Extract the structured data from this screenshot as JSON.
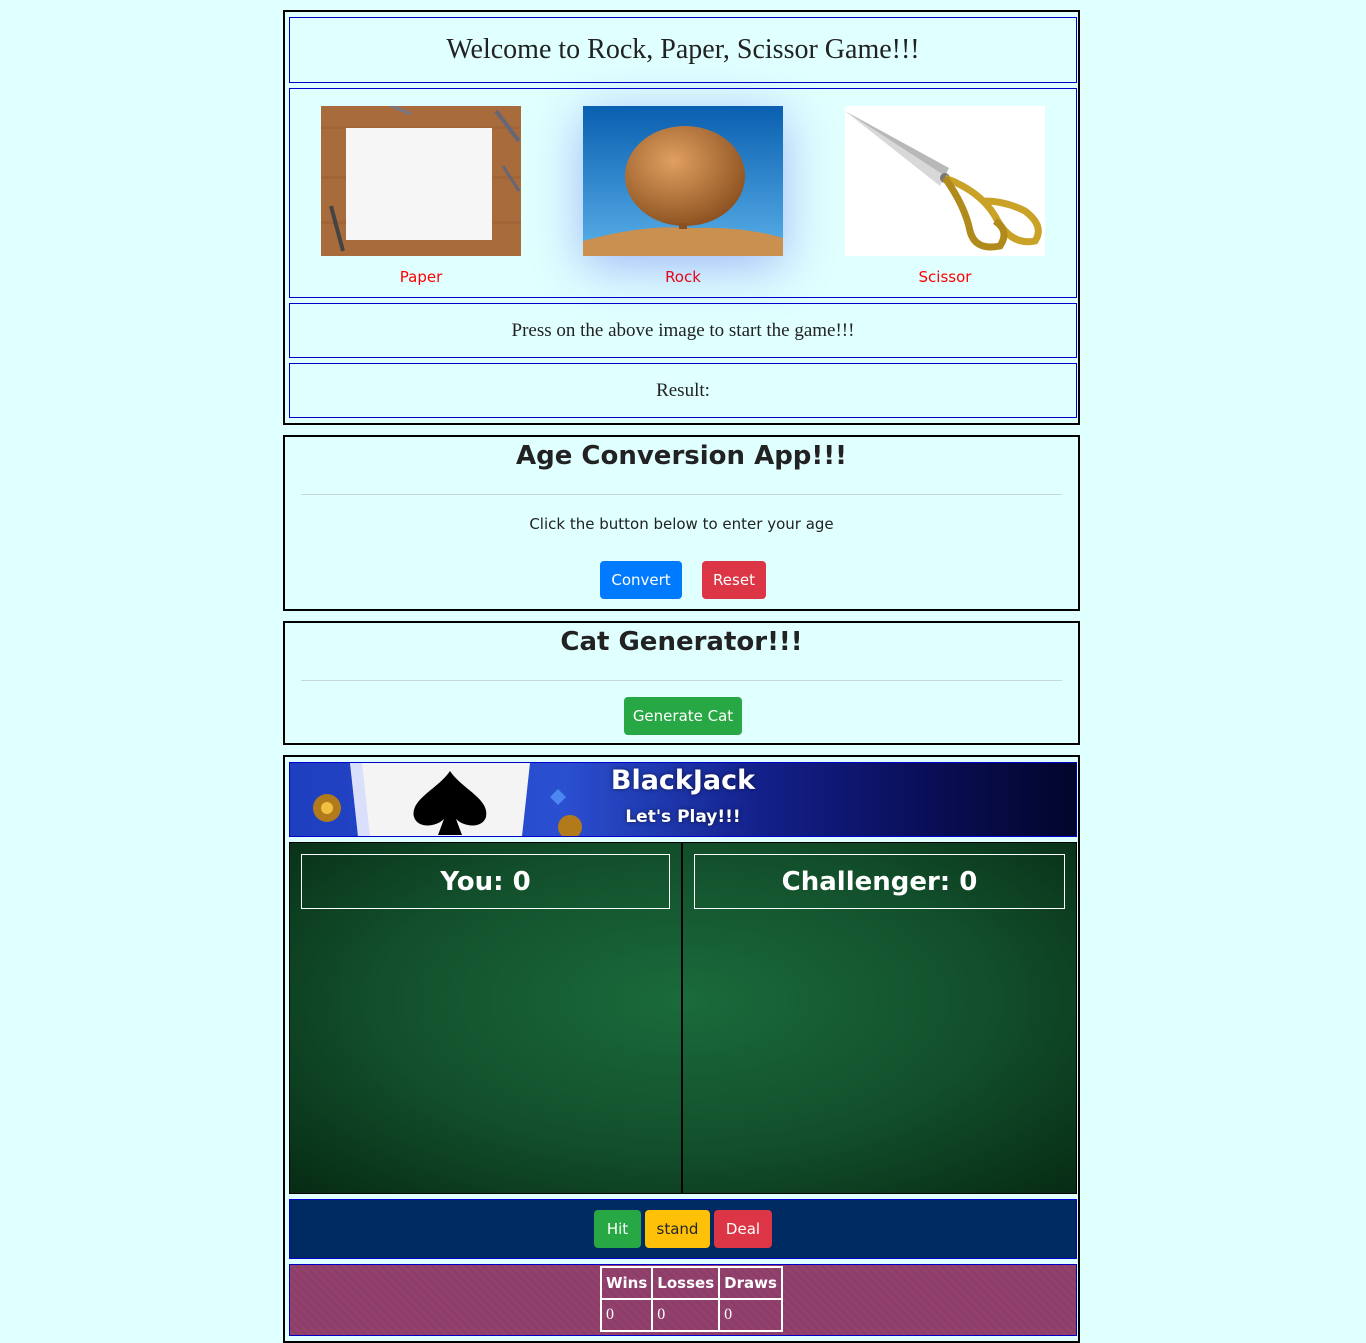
{
  "rps": {
    "title": "Welcome to Rock, Paper, Scissor Game!!!",
    "choices": [
      {
        "label": "Paper"
      },
      {
        "label": "Rock"
      },
      {
        "label": "Scissor"
      }
    ],
    "message": "Press on the above image to start the game!!!",
    "result_label": "Result:"
  },
  "age": {
    "title": "Age Conversion App!!!",
    "subtitle": "Click the button below to enter your age",
    "convert_label": "Convert",
    "reset_label": "Reset"
  },
  "cat": {
    "title": "Cat Generator!!!",
    "generate_label": "Generate Cat"
  },
  "blackjack": {
    "title": "BlackJack",
    "subtitle": "Let's Play!!!",
    "you_score": "You: 0",
    "challenger_score": "Challenger: 0",
    "hit_label": "Hit",
    "stand_label": "stand",
    "deal_label": "Deal",
    "stats": {
      "headers": [
        "Wins",
        "Losses",
        "Draws"
      ],
      "values": [
        "0",
        "0",
        "0"
      ]
    }
  },
  "colors": {
    "page_bg": "#e0ffff",
    "choice_label": "#ff0000",
    "primary": "#007bff",
    "danger": "#dc3545",
    "success": "#28a745",
    "warning": "#ffc107",
    "controls_bg": "#002b62",
    "stats_bg": "#8f3f68"
  }
}
